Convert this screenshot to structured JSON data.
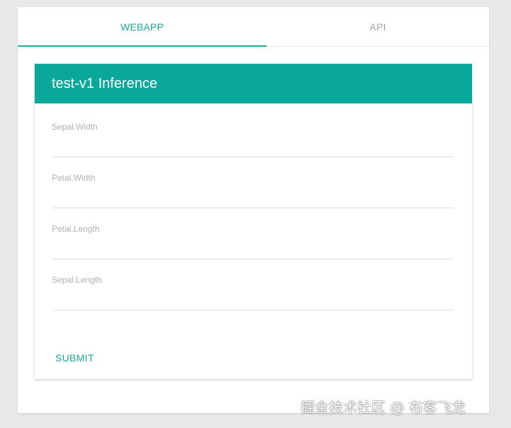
{
  "tabs": [
    {
      "label": "WEBAPP",
      "active": true
    },
    {
      "label": "API",
      "active": false
    }
  ],
  "card": {
    "title": "test-v1 Inference",
    "fields": [
      {
        "label": "Sepal.Width",
        "value": ""
      },
      {
        "label": "Petal.Width",
        "value": ""
      },
      {
        "label": "Petal.Length",
        "value": ""
      },
      {
        "label": "Sepal.Length",
        "value": ""
      }
    ],
    "submit_label": "SUBMIT"
  },
  "watermark": "掘金技术社区 @ 布客飞龙",
  "colors": {
    "accent": "#1aa89c",
    "header_bg": "#0aa89a",
    "inactive_tab": "#a3a3a3",
    "label": "#b0b0b0"
  }
}
